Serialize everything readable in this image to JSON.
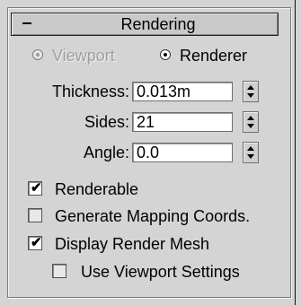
{
  "rollout": {
    "title": "Rendering",
    "collapse_symbol": "-"
  },
  "mode": {
    "options": [
      {
        "label": "Viewport",
        "selected": false,
        "enabled": false
      },
      {
        "label": "Renderer",
        "selected": true,
        "enabled": true
      }
    ]
  },
  "fields": {
    "thickness": {
      "label": "Thickness:",
      "value": "0.013m"
    },
    "sides": {
      "label": "Sides:",
      "value": "21"
    },
    "angle": {
      "label": "Angle:",
      "value": "0.0"
    }
  },
  "checks": {
    "renderable": {
      "label": "Renderable",
      "checked": true
    },
    "generate_mapping": {
      "label": "Generate Mapping Coords.",
      "checked": false
    },
    "display_render_mesh": {
      "label": "Display Render Mesh",
      "checked": true
    },
    "use_viewport_settings": {
      "label": "Use Viewport Settings",
      "checked": false
    }
  },
  "icons": {
    "collapse": "minus-icon",
    "spinner": "spinner-arrows-icon",
    "check": "checkmark-icon"
  },
  "colors": {
    "panel_bg": "#d4d4d4",
    "disabled_text": "#a0a0a0"
  }
}
